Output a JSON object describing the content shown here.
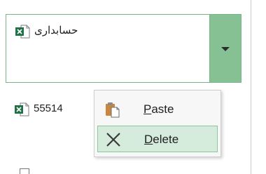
{
  "files": [
    {
      "name": "حسابداری",
      "icon": "excel-file-icon",
      "selected": true
    },
    {
      "name": "55514",
      "icon": "excel-file-icon",
      "selected": false
    }
  ],
  "context_menu": {
    "items": [
      {
        "label_accel": "P",
        "label_rest": "aste",
        "icon": "paste-icon",
        "highlighted": false
      },
      {
        "label_accel": "D",
        "label_rest": "elete",
        "icon": "delete-x-icon",
        "highlighted": true
      }
    ]
  },
  "colors": {
    "selection_fill": "#86c194",
    "selection_border": "#76b785",
    "menu_highlight": "#d5ebdc",
    "excel_green": "#1e7145"
  }
}
